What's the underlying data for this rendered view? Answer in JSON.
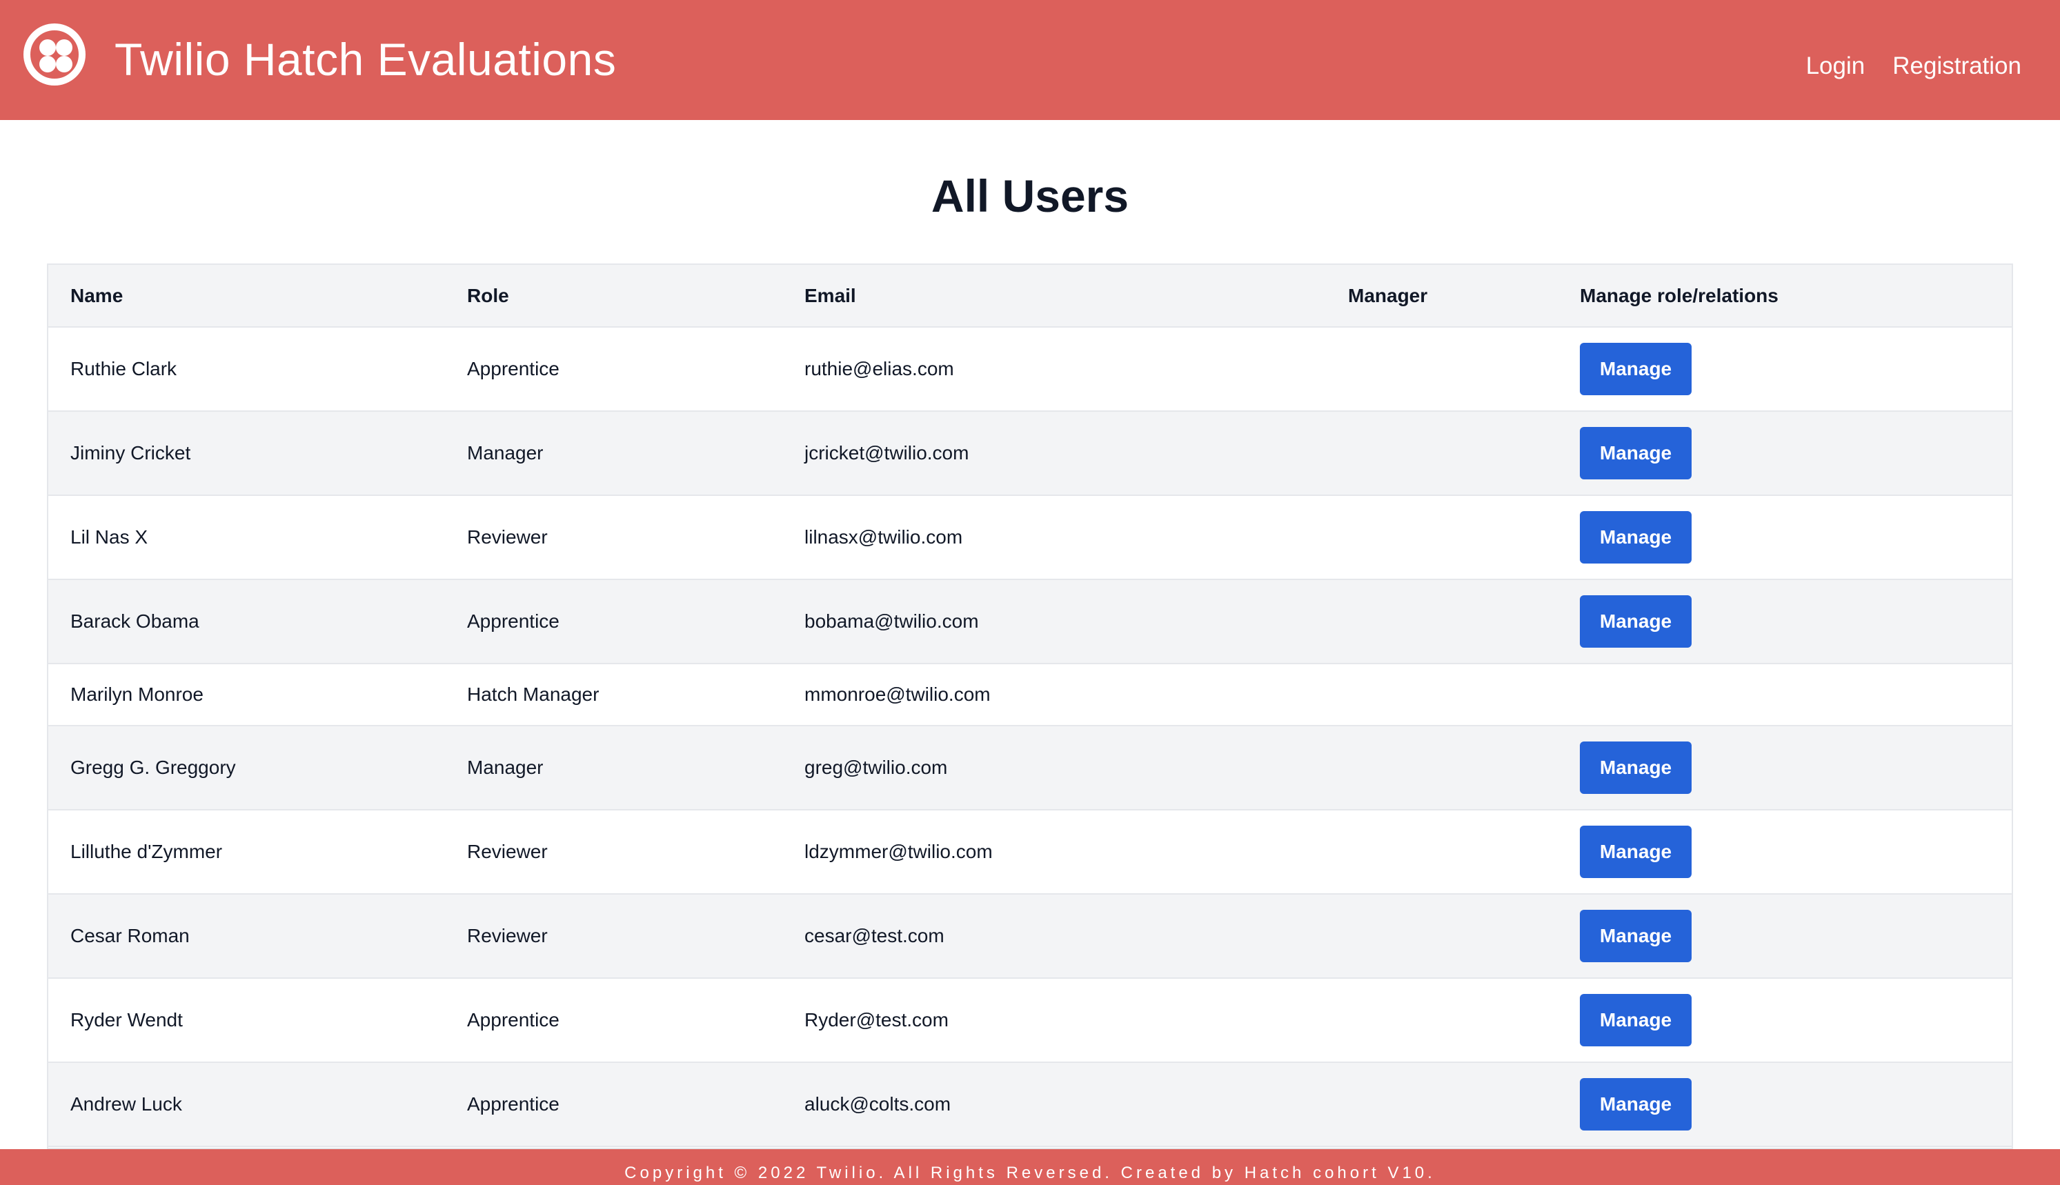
{
  "header": {
    "title": "Twilio Hatch Evaluations",
    "nav": {
      "login": "Login",
      "registration": "Registration"
    }
  },
  "page": {
    "heading": "All Users"
  },
  "table": {
    "columns": {
      "name": "Name",
      "role": "Role",
      "email": "Email",
      "manager": "Manager",
      "manage": "Manage role/relations"
    },
    "rows": [
      {
        "name": "Ruthie Clark",
        "role": "Apprentice",
        "email": "ruthie@elias.com",
        "manager": "",
        "action": "Manage"
      },
      {
        "name": "Jiminy Cricket",
        "role": "Manager",
        "email": "jcricket@twilio.com",
        "manager": "",
        "action": "Manage"
      },
      {
        "name": "Lil Nas X",
        "role": "Reviewer",
        "email": "lilnasx@twilio.com",
        "manager": "",
        "action": "Manage"
      },
      {
        "name": "Barack Obama",
        "role": "Apprentice",
        "email": "bobama@twilio.com",
        "manager": "",
        "action": "Manage"
      },
      {
        "name": "Marilyn Monroe",
        "role": "Hatch Manager",
        "email": "mmonroe@twilio.com",
        "manager": "",
        "action": ""
      },
      {
        "name": "Gregg G. Greggory",
        "role": "Manager",
        "email": "greg@twilio.com",
        "manager": "",
        "action": "Manage"
      },
      {
        "name": "Lilluthe d'Zymmer",
        "role": "Reviewer",
        "email": "ldzymmer@twilio.com",
        "manager": "",
        "action": "Manage"
      },
      {
        "name": "Cesar Roman",
        "role": "Reviewer",
        "email": "cesar@test.com",
        "manager": "",
        "action": "Manage"
      },
      {
        "name": "Ryder Wendt",
        "role": "Apprentice",
        "email": "Ryder@test.com",
        "manager": "",
        "action": "Manage"
      },
      {
        "name": "Andrew Luck",
        "role": "Apprentice",
        "email": "aluck@colts.com",
        "manager": "",
        "action": "Manage"
      }
    ]
  },
  "footer": {
    "text": "Copyright © 2022 Twilio. All Rights Reversed. Created by Hatch cohort V10."
  },
  "colors": {
    "brand": "#dc605b",
    "button": "#2563d9"
  }
}
